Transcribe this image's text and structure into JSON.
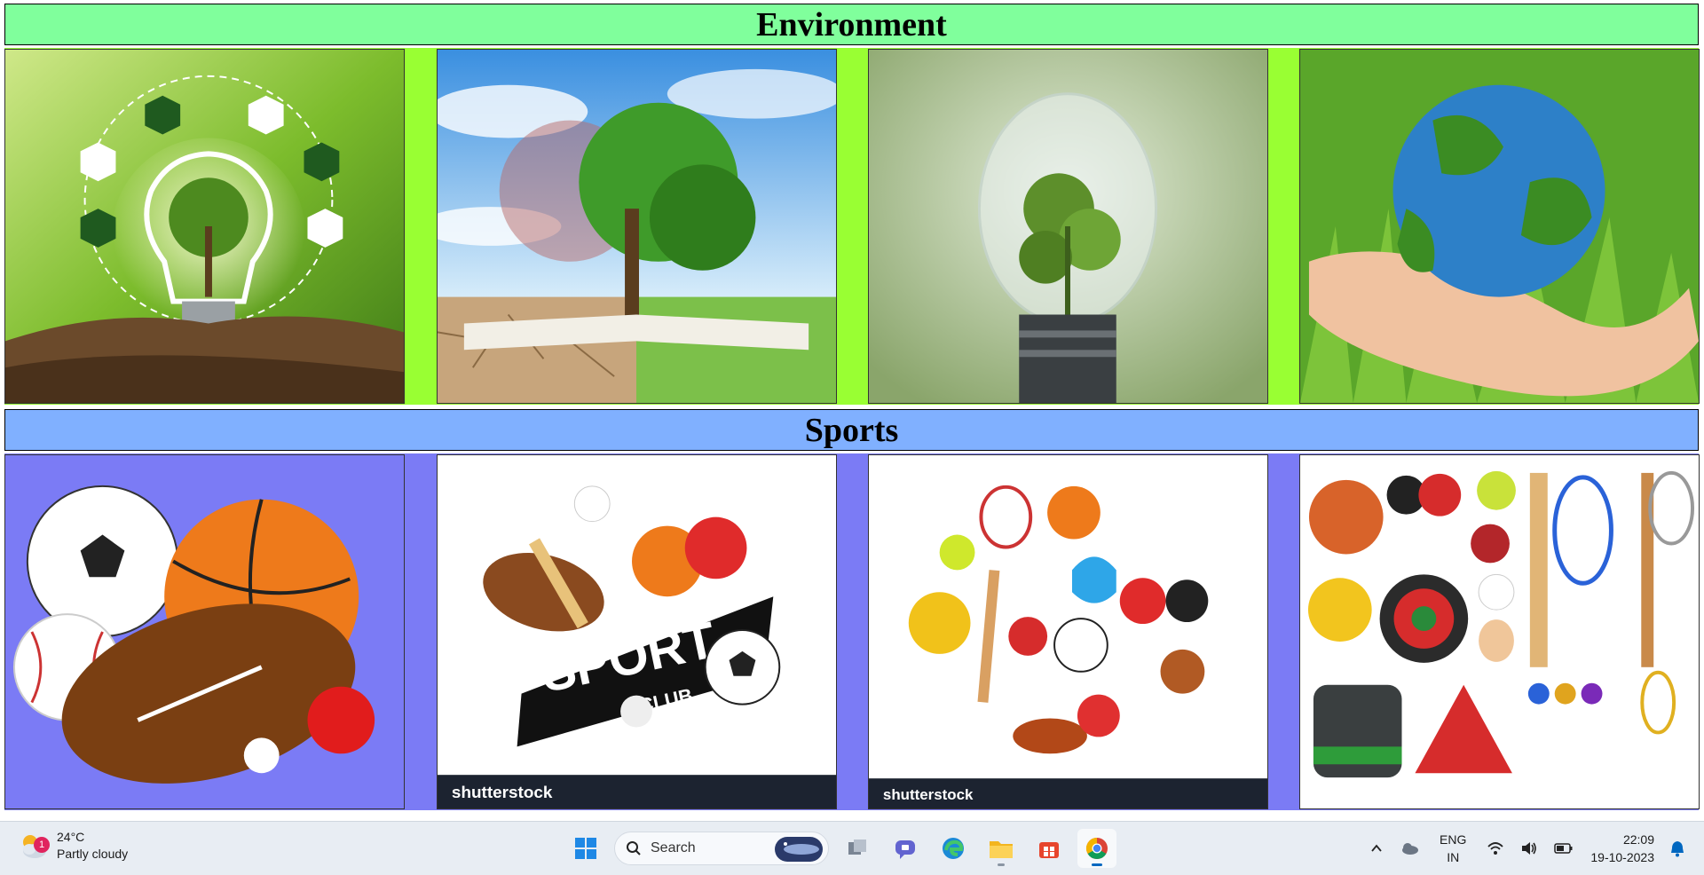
{
  "sections": {
    "environment": {
      "title": "Environment",
      "background": "#99ff33",
      "header_background": "#80ff9c"
    },
    "sports": {
      "title": "Sports",
      "background": "#7b7bf5",
      "header_background": "#80b0ff"
    }
  },
  "sports_images": {
    "sport_club_word": "SPORT",
    "club_word": "CLUB",
    "watermark": "shutterstock"
  },
  "taskbar": {
    "weather": {
      "temp": "24°C",
      "condition": "Partly cloudy",
      "badge": "1"
    },
    "search": {
      "label": "Search"
    },
    "language": {
      "line1": "ENG",
      "line2": "IN"
    },
    "clock": {
      "time": "22:09",
      "date": "19-10-2023"
    },
    "accent": "#0067c0"
  }
}
